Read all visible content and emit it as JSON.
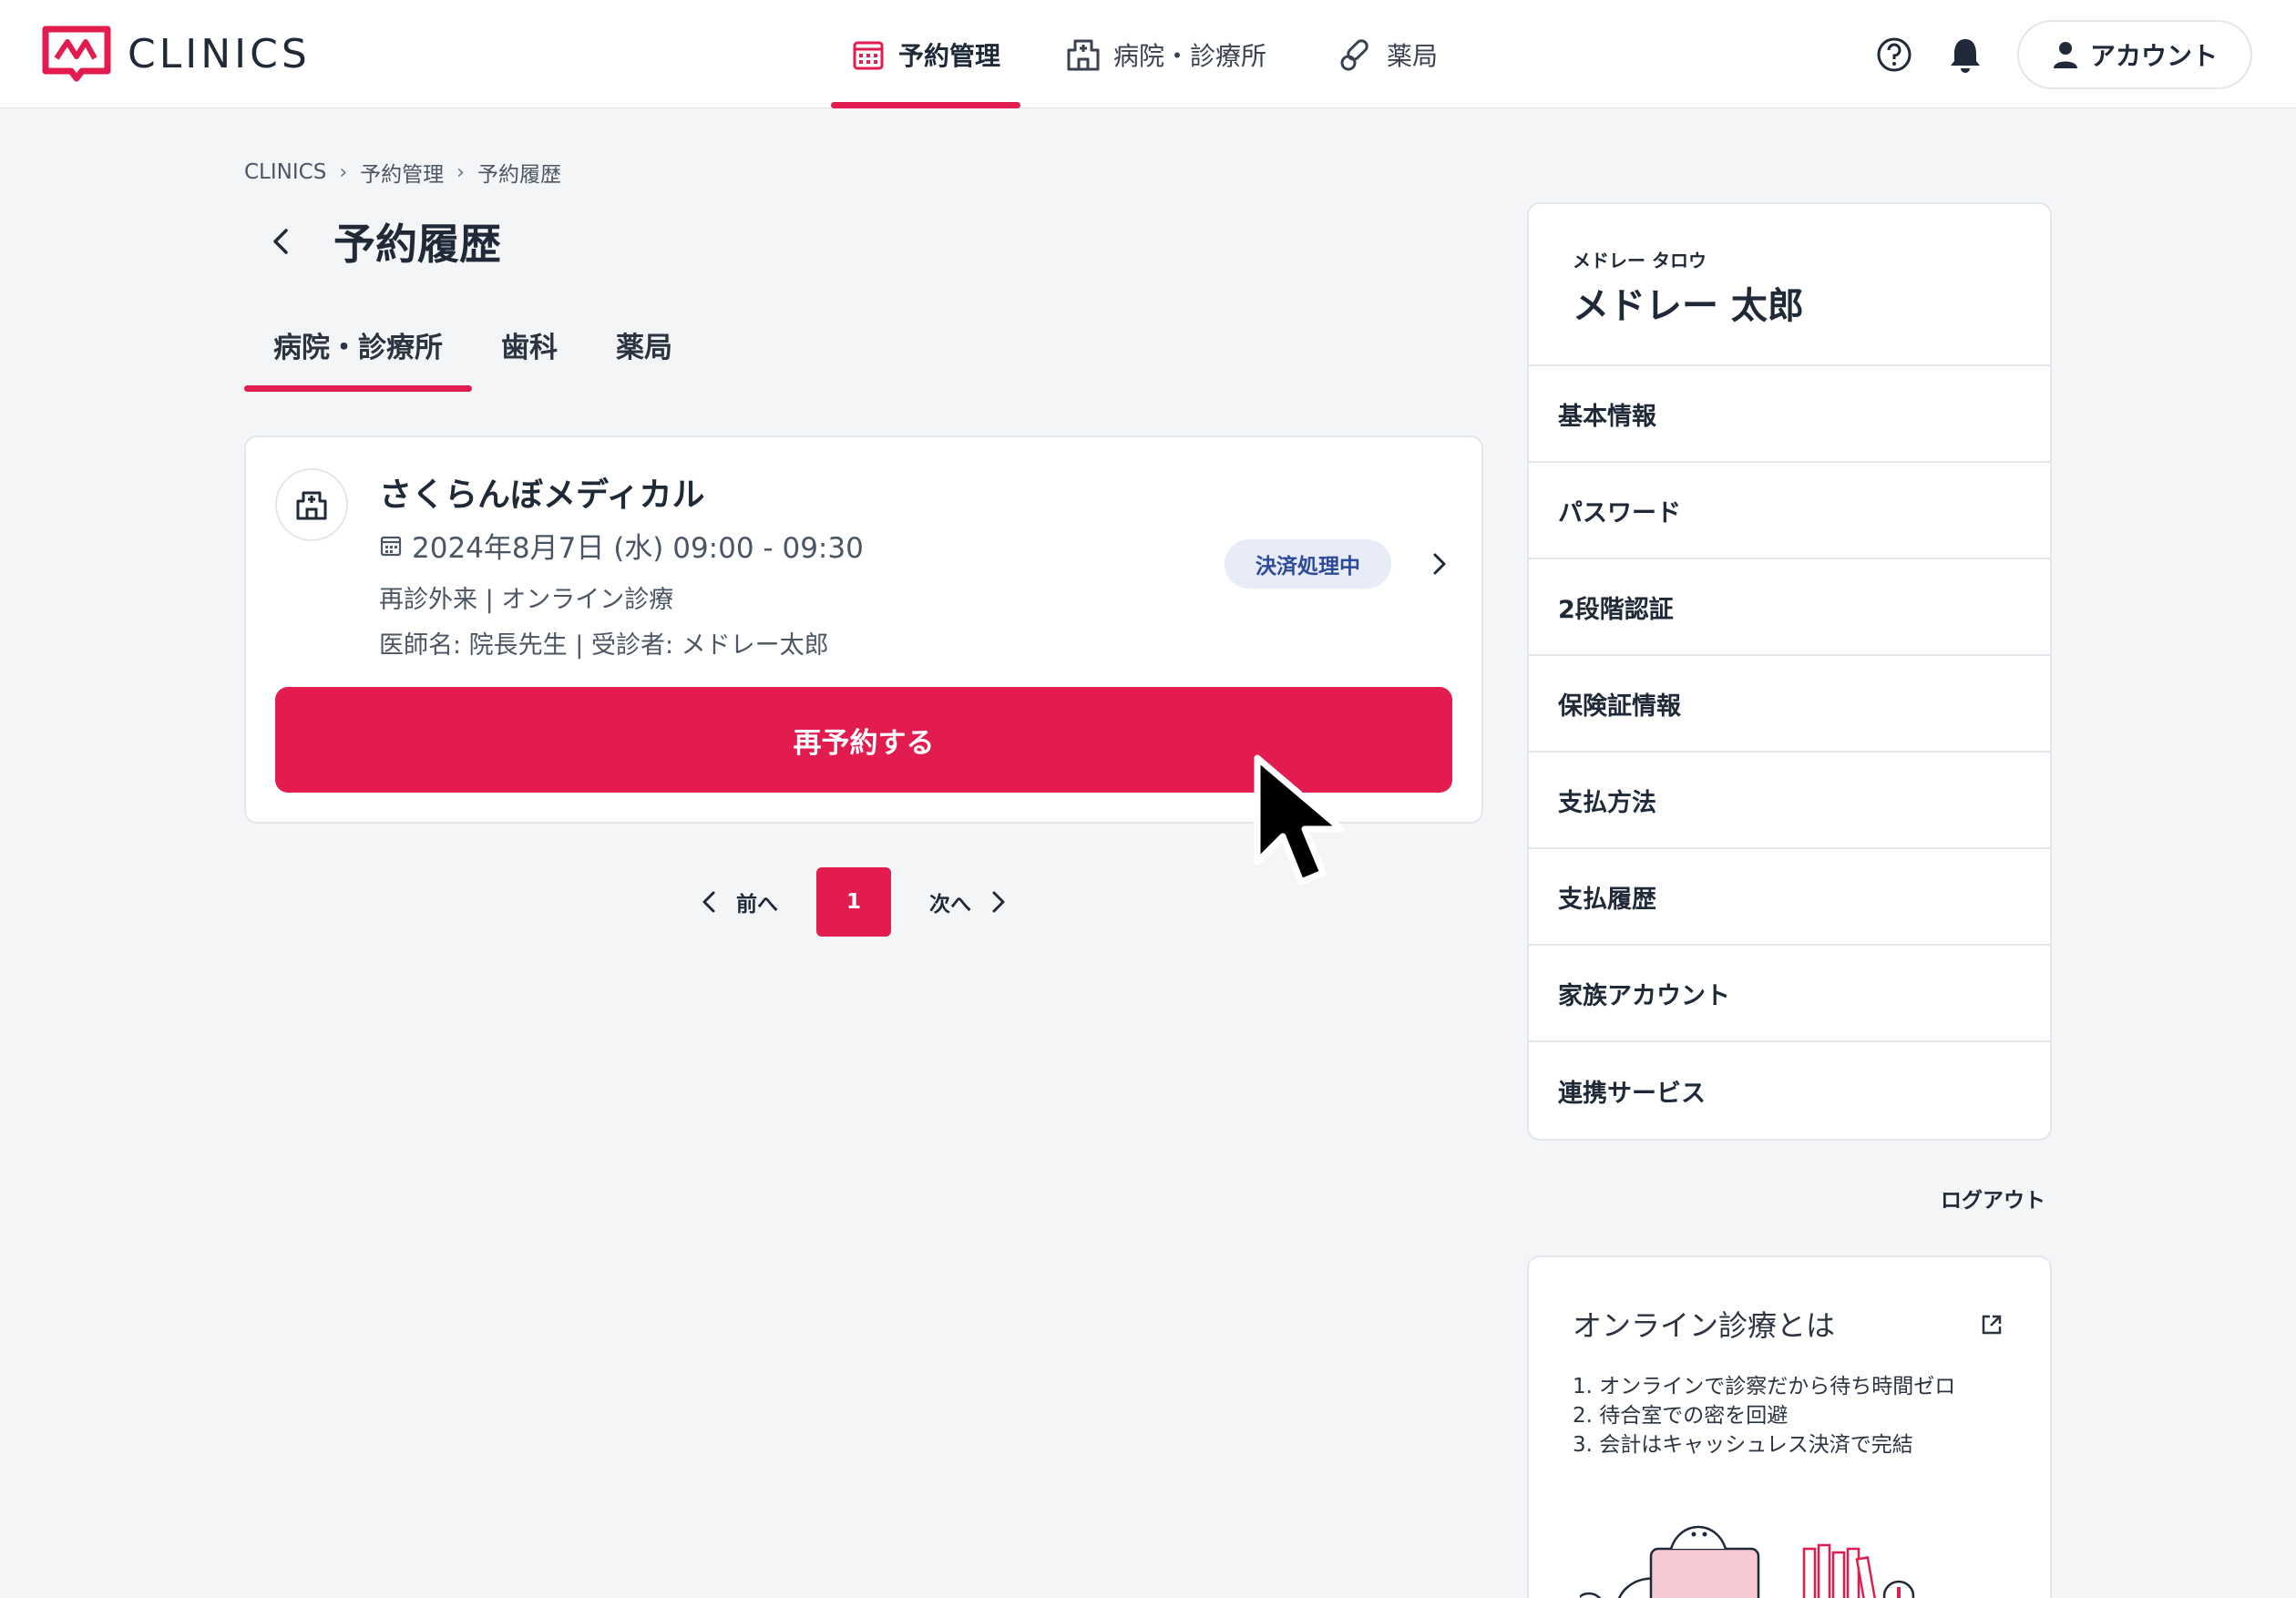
{
  "header": {
    "logo_text": "CLINICS",
    "nav": [
      {
        "label": "予約管理",
        "icon": "calendar-icon",
        "active": true
      },
      {
        "label": "病院・診療所",
        "icon": "hospital-icon",
        "active": false
      },
      {
        "label": "薬局",
        "icon": "pills-icon",
        "active": false
      }
    ],
    "account_label": "アカウント"
  },
  "breadcrumb": [
    "CLINICS",
    "予約管理",
    "予約履歴"
  ],
  "page_title": "予約履歴",
  "tabs": [
    {
      "label": "病院・診療所",
      "active": true
    },
    {
      "label": "歯科",
      "active": false
    },
    {
      "label": "薬局",
      "active": false
    }
  ],
  "reservation": {
    "facility_name": "さくらんぼメディカル",
    "datetime": "2024年8月7日 (水) 09:00 - 09:30",
    "detail_type": "再診外来 | オンライン診療",
    "detail_people": "医師名: 院長先生 | 受診者: メドレー太郎",
    "status": "決済処理中",
    "rebook_label": "再予約する"
  },
  "pagination": {
    "prev_label": "前へ",
    "current": "1",
    "next_label": "次へ"
  },
  "profile": {
    "kana": "メドレー タロウ",
    "name": "メドレー 太郎"
  },
  "menu": [
    "基本情報",
    "パスワード",
    "2段階認証",
    "保険証情報",
    "支払方法",
    "支払履歴",
    "家族アカウント",
    "連携サービス"
  ],
  "logout_label": "ログアウト",
  "info": {
    "title": "オンライン診療とは",
    "items": [
      "1. オンラインで診察だから待ち時間ゼロ",
      "2. 待合室での密を回避",
      "3. 会計はキャッシュレス決済で完結"
    ]
  },
  "colors": {
    "accent": "#e31c4f",
    "badge_bg": "#e7ecf8",
    "badge_text": "#2e4a9b",
    "page_bg": "#f4f5f7"
  }
}
